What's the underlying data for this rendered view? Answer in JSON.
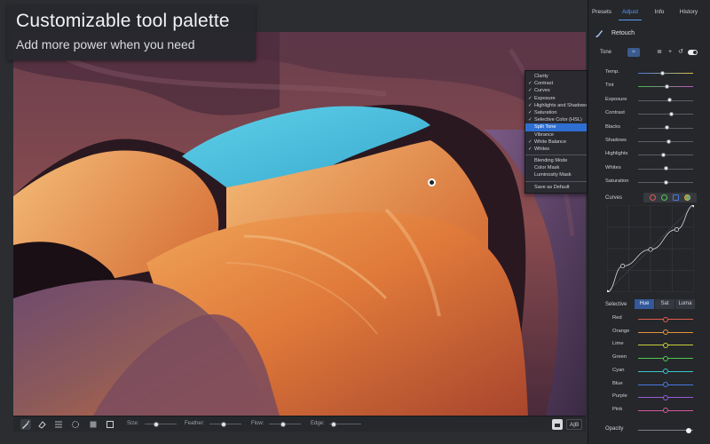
{
  "promo": {
    "title": "Customizable tool palette",
    "subtitle": "Add more power when you need"
  },
  "context_menu": {
    "items": [
      {
        "label": "Clarity",
        "checked": false,
        "selected": false
      },
      {
        "label": "Contrast",
        "checked": true,
        "selected": false
      },
      {
        "label": "Curves",
        "checked": true,
        "selected": false
      },
      {
        "label": "Exposure",
        "checked": true,
        "selected": false
      },
      {
        "label": "Highlights and Shadows",
        "checked": true,
        "selected": false
      },
      {
        "label": "Saturation",
        "checked": true,
        "selected": false
      },
      {
        "label": "Selective Color (HSL)",
        "checked": true,
        "selected": false
      },
      {
        "label": "Split Tone",
        "checked": false,
        "selected": true
      },
      {
        "label": "Vibrance",
        "checked": false,
        "selected": false
      },
      {
        "label": "White Balance",
        "checked": true,
        "selected": false
      },
      {
        "label": "Whites",
        "checked": true,
        "selected": false
      }
    ],
    "items2": [
      {
        "label": "Blending Mode"
      },
      {
        "label": "Color Mask"
      },
      {
        "label": "Luminosity Mask"
      }
    ],
    "items3": [
      {
        "label": "Save as Default"
      }
    ]
  },
  "brush_toolbar": {
    "tools": [
      "brush-icon",
      "eraser-icon",
      "gradient-icon",
      "radial-icon",
      "fill-icon",
      "mask-icon"
    ],
    "size_label": "Size:",
    "feather_label": "Feather:",
    "flow_label": "Flow:",
    "edge_label": "Edge:",
    "size_value": 0.35,
    "feather_value": 0.45,
    "flow_value": 0.45,
    "edge_value": 0.15,
    "compare_label": "A|B"
  },
  "sidebar": {
    "tabs": [
      {
        "label": "Presets",
        "active": false
      },
      {
        "label": "Adjust",
        "active": true
      },
      {
        "label": "Info",
        "active": false
      },
      {
        "label": "History",
        "active": false
      }
    ],
    "retouch_label": "Retouch",
    "tone_label": "Tone",
    "adjustments": [
      {
        "label": "Temp.",
        "value": 0.45,
        "fill": "temp"
      },
      {
        "label": "Tint",
        "value": 0.52,
        "fill": "tint"
      },
      {
        "label": "Exposure",
        "value": 0.58,
        "fill": "none"
      },
      {
        "label": "Contrast",
        "value": 0.6,
        "fill": "none"
      },
      {
        "label": "Blacks",
        "value": 0.52,
        "fill": "none"
      },
      {
        "label": "Shadows",
        "value": 0.56,
        "fill": "none"
      },
      {
        "label": "Highlights",
        "value": 0.46,
        "fill": "none"
      },
      {
        "label": "Whites",
        "value": 0.5,
        "fill": "none"
      },
      {
        "label": "Saturation",
        "value": 0.5,
        "fill": "none"
      }
    ],
    "curves_label": "Curves",
    "curve_points": [
      [
        0,
        0
      ],
      [
        0.18,
        0.3
      ],
      [
        0.5,
        0.49
      ],
      [
        0.8,
        0.72
      ],
      [
        1,
        1
      ]
    ],
    "selective_label": "Selective",
    "selective_modes": [
      {
        "label": "Hue",
        "active": true
      },
      {
        "label": "Sat",
        "active": false
      },
      {
        "label": "Luma",
        "active": false
      }
    ],
    "colors": [
      {
        "label": "Red",
        "color": "#e45a4d"
      },
      {
        "label": "Orange",
        "color": "#e5933a"
      },
      {
        "label": "Lime",
        "color": "#c8cf3a"
      },
      {
        "label": "Green",
        "color": "#4fca4f"
      },
      {
        "label": "Cyan",
        "color": "#3ec4c9"
      },
      {
        "label": "Blue",
        "color": "#4a78e0"
      },
      {
        "label": "Purple",
        "color": "#9b5ad8"
      },
      {
        "label": "Pink",
        "color": "#d6579e"
      }
    ],
    "opacity_label": "Opacity",
    "opacity_value": 0.92
  },
  "colors": {
    "accent": "#5b9cf5",
    "selection": "#2e6fd1"
  }
}
